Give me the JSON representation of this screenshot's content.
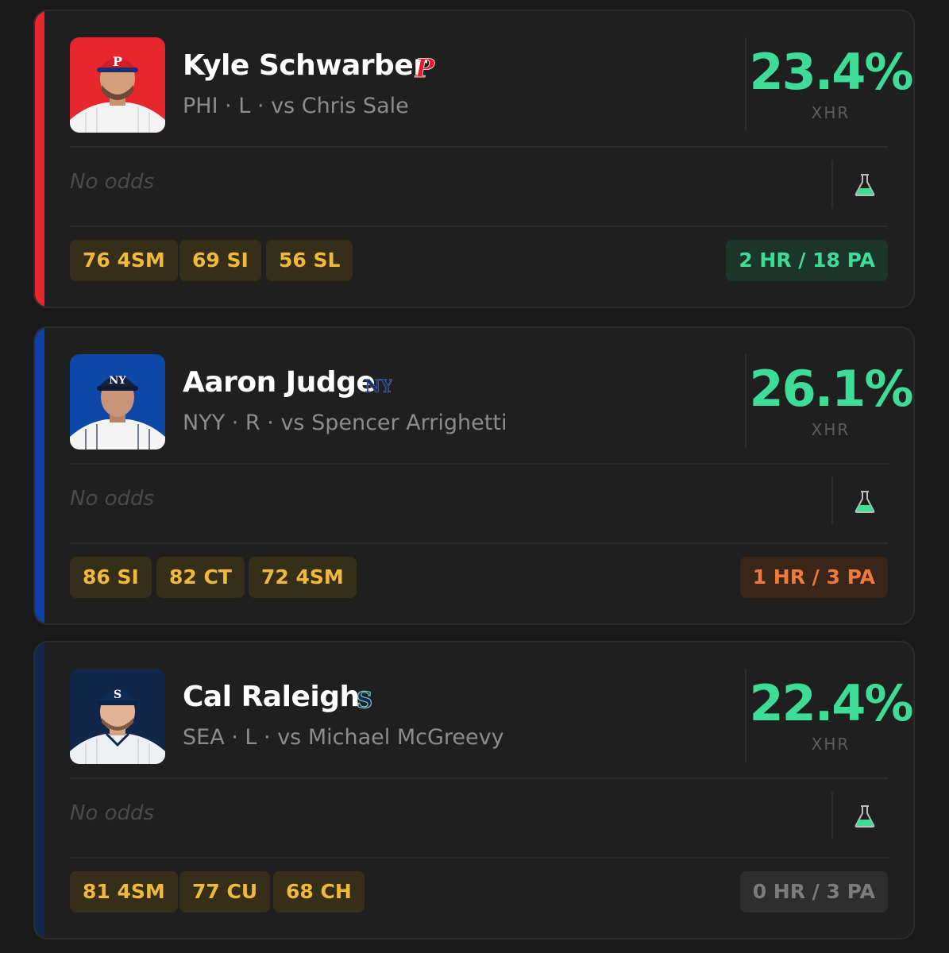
{
  "cards": [
    {
      "name": "Kyle Schwarber",
      "subtitle": "PHI · L · vs Chris Sale",
      "xhr_value": "23.4%",
      "xhr_label": "XHR",
      "odds_text": "No odds",
      "team_logo_icon": "phillies-p-logo-icon",
      "accent_color": "#e8262e",
      "pitches": [
        "76 4SM",
        "69 SI",
        "56 SL"
      ],
      "hr_pa": "2 HR / 18 PA",
      "hr_pa_style": "green"
    },
    {
      "name": "Aaron Judge",
      "subtitle": "NYY · R · vs Spencer Arrighetti",
      "xhr_value": "26.1%",
      "xhr_label": "XHR",
      "odds_text": "No odds",
      "team_logo_icon": "yankees-ny-logo-icon",
      "accent_color": "#0f3fa6",
      "pitches": [
        "86 SI",
        "82 CT",
        "72 4SM"
      ],
      "hr_pa": "1 HR / 3 PA",
      "hr_pa_style": "orange"
    },
    {
      "name": "Cal Raleigh",
      "subtitle": "SEA · L · vs Michael McGreevy",
      "xhr_value": "22.4%",
      "xhr_label": "XHR",
      "odds_text": "No odds",
      "team_logo_icon": "mariners-s-logo-icon",
      "accent_color": "#12284a",
      "pitches": [
        "81 4SM",
        "77 CU",
        "68 CH"
      ],
      "hr_pa": "0 HR / 3 PA",
      "hr_pa_style": "gray"
    }
  ],
  "colors": {
    "xhr_green": "#3ddc97",
    "pill_bg": "#362e18",
    "pill_text": "#f0b93c",
    "hr_green_bg": "#1c3429",
    "hr_green_text": "#3ddc97",
    "hr_orange_bg": "#3a2619",
    "hr_orange_text": "#f07a3c",
    "hr_gray_bg": "#2e2e2e",
    "hr_gray_text": "#7c7c7c"
  },
  "icons": {
    "odds_action": "flask-icon"
  }
}
